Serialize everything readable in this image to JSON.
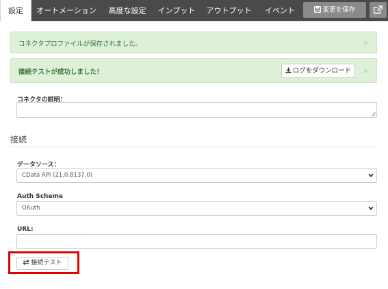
{
  "nav": {
    "tabs": [
      {
        "label": "設定"
      },
      {
        "label": "オートメーション"
      },
      {
        "label": "高度な設定"
      },
      {
        "label": "インプット"
      },
      {
        "label": "アウトプット"
      },
      {
        "label": "イベント"
      }
    ],
    "active_tab": "設定",
    "save_label": "変更を保存",
    "icons": {
      "save": "save-icon",
      "external": "external-link-icon"
    }
  },
  "alerts": {
    "profile_saved": "コネクタプロファイルが保存されました。",
    "test_success": "接続テストが成功しました！",
    "download_log_label": "ログをダウンロード",
    "close_glyph": "×"
  },
  "form": {
    "description_label": "コネクタの説明：",
    "description_value": "",
    "section_connection": "接続",
    "datasource_label": "データソース：",
    "datasource_value": "CData API (21.0.8137.0)",
    "auth_label": "Auth Scheme",
    "auth_value": "OAuth",
    "url_label": "URL:",
    "url_value": "",
    "test_button_label": "接続テスト"
  },
  "colors": {
    "navbar": "#4a4a4a",
    "alert_bg": "#dff0d8",
    "alert_text": "#3c763d",
    "highlight": "#e00000"
  }
}
